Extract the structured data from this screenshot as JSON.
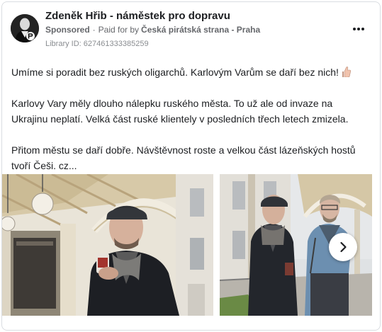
{
  "post": {
    "author": "Zdeněk Hřib - náměstek pro dopravu",
    "sponsored": "Sponsored",
    "paid_for_prefix": "Paid for by",
    "advertiser": "Česká pirátská strana - Praha",
    "library_id": "Library ID: 627461333385259",
    "paragraphs": [
      "Umíme si poradit bez ruských oligarchů. Karlovým Varům se daří bez nich!",
      "Karlovy Vary měly dlouho nálepku ruského města. To už ale od invaze na Ukrajinu neplatí. Velká část ruské klientely v posledních třech letech zmizela.",
      "Přitom městu se daří dobře. Návštěvnost roste a velkou část lázeňských hostů tvoří Češi. cz..."
    ],
    "emoji": "thumbs-up-icon"
  },
  "carousel": {
    "photos": [
      {
        "name": "photo-man-in-colonnade"
      },
      {
        "name": "photo-two-men-talking"
      }
    ],
    "next_icon": "chevron-right-icon"
  },
  "colors": {
    "text": "#1c1e21",
    "secondary": "#65676b",
    "muted": "#8a8d91",
    "border": "#dadde1"
  }
}
